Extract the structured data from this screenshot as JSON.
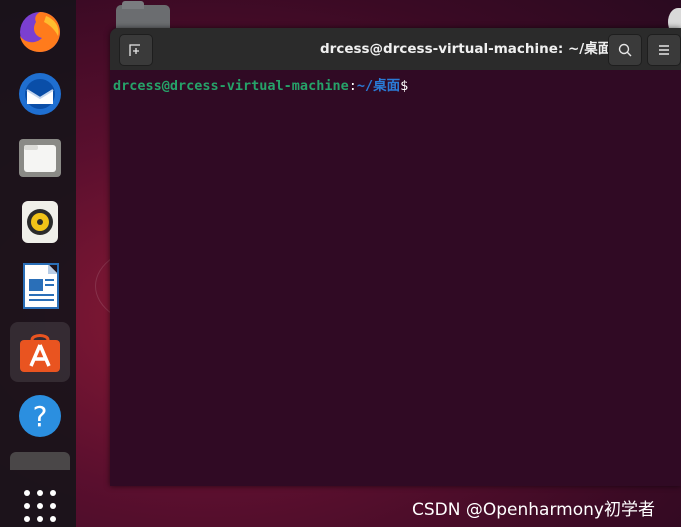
{
  "window": {
    "title": "drcess@drcess-virtual-machine: ~/桌面",
    "new_tab_icon": "new-tab-icon",
    "search_icon": "search-icon",
    "menu_icon": "hamburger-menu-icon"
  },
  "terminal": {
    "prompt_user": "drcess@drcess-virtual-machine",
    "prompt_sep": ":",
    "prompt_path": "~/桌面",
    "prompt_symbol": "$"
  },
  "dock": {
    "items": [
      {
        "name": "firefox",
        "icon": "firefox-icon"
      },
      {
        "name": "thunderbird",
        "icon": "thunderbird-icon"
      },
      {
        "name": "files",
        "icon": "files-icon"
      },
      {
        "name": "rhythmbox",
        "icon": "rhythmbox-icon"
      },
      {
        "name": "libreoffice-writer",
        "icon": "writer-icon"
      },
      {
        "name": "ubuntu-software",
        "icon": "software-center-icon"
      },
      {
        "name": "help",
        "icon": "help-icon"
      }
    ],
    "help_glyph": "?",
    "show_apps_icon": "show-applications-icon"
  },
  "watermark": "CSDN @Openharmony初学者",
  "colors": {
    "terminal_bg": "#300a24",
    "titlebar_bg": "#2b2b2b",
    "prompt_user": "#26a269",
    "prompt_path": "#2a7bd6",
    "software_orange": "#e95420",
    "help_blue": "#2b8fe0"
  }
}
